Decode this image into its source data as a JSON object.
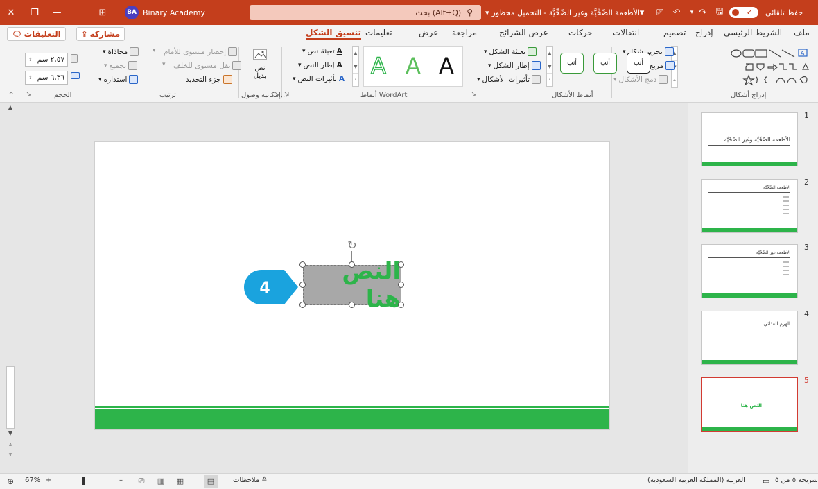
{
  "titlebar": {
    "autosave_label": "حفظ تلقائي",
    "doc_title": "الأطعمة الصِّحِّيَّة وغير الصِّحِّيَّة - التحميل محظور",
    "title_chevron": "▾",
    "search_placeholder": "بحث (Alt+Q)",
    "user_name": "Binary Academy",
    "user_initials": "BA"
  },
  "tabs": {
    "file": "ملف",
    "home": "الشريط الرئيسي",
    "insert": "إدراج",
    "design": "تصميم",
    "transitions": "انتقالات",
    "animations": "حركات",
    "slideshow": "عرض الشرائح",
    "review": "مراجعة",
    "view": "عرض",
    "help": "تعليمات",
    "shape_format": "تنسيق الشكل",
    "share": "مشاركة",
    "comments": "التعليقات"
  },
  "ribbon": {
    "insert_shapes": {
      "label": "إدراج أشكال",
      "edit_shape": "تحرير شكل",
      "text_box": "مربع نص",
      "merge_shapes": "دمج الأشكال"
    },
    "shape_styles": {
      "label": "أنماط الأشكال",
      "swatch_text": "أنب",
      "fill": "تعبئة الشكل",
      "outline": "إطار الشكل",
      "effects": "تأثيرات الأشكال"
    },
    "wordart": {
      "label": "أنماط WordArt",
      "letter": "A",
      "text_fill": "تعبئة نص",
      "text_outline": "إطار النص",
      "text_effects": "تأثيرات النص"
    },
    "accessibility": {
      "label": "إمكانية وصول...",
      "alt_text": "نص بديل"
    },
    "arrange": {
      "label": "ترتيب",
      "bring_forward": "إحضار مستوى للأمام",
      "send_backward": "نقل مستوى للخلف",
      "selection_pane": "جزء التحديد",
      "align": "محاذاة",
      "group": "تجميع",
      "rotate": "استدارة"
    },
    "size": {
      "label": "الحجم",
      "height": "٢,٥٧ سم",
      "width": "٦,٣٦ سم"
    }
  },
  "slide": {
    "textbox_text": "النص هنا",
    "callout_number": "4"
  },
  "thumbnails": [
    {
      "num": "1",
      "title": "الأطعمة الصِّحِّيَّة وغير الصِّحِّيَّة"
    },
    {
      "num": "2",
      "title": "الأطعمة الصِّحِّيَّة"
    },
    {
      "num": "3",
      "title": "الأطعمة غير الصِّحِّيَّة"
    },
    {
      "num": "4",
      "title": "الهرم الغذائي"
    },
    {
      "num": "5",
      "title": "النص هنا"
    }
  ],
  "statusbar": {
    "slide_info": "شريحة ٥ من ٥",
    "language": "العربية (المملكة العربية السعودية)",
    "notes": "ملاحظات",
    "zoom": "67%",
    "zoom_plus": "+",
    "zoom_minus": "–"
  },
  "colors": {
    "accent": "#c43e1c",
    "slide_green": "#2db44a",
    "selected_thumb": "#d23b32",
    "callout_blue": "#1aa3de"
  }
}
